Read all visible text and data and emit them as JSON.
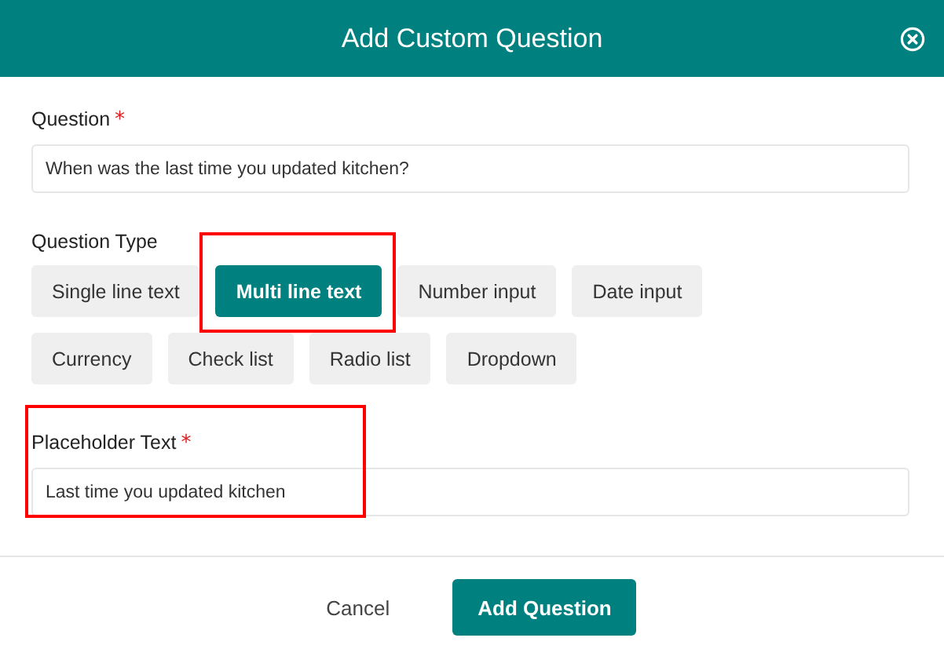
{
  "dialog": {
    "title": "Add Custom Question"
  },
  "question": {
    "label": "Question",
    "required_mark": "*",
    "value": "When was the last time you updated kitchen?"
  },
  "question_type": {
    "label": "Question Type",
    "options": [
      {
        "label": "Single line text",
        "selected": false,
        "highlighted": false
      },
      {
        "label": "Multi line text",
        "selected": true,
        "highlighted": true
      },
      {
        "label": "Number input",
        "selected": false,
        "highlighted": false
      },
      {
        "label": "Date input",
        "selected": false,
        "highlighted": false
      },
      {
        "label": "Currency",
        "selected": false,
        "highlighted": false
      },
      {
        "label": "Check list",
        "selected": false,
        "highlighted": false
      },
      {
        "label": "Radio list",
        "selected": false,
        "highlighted": false
      },
      {
        "label": "Dropdown",
        "selected": false,
        "highlighted": false
      }
    ]
  },
  "placeholder_text": {
    "label": "Placeholder Text",
    "required_mark": "*",
    "value": "Last time you updated kitchen",
    "highlighted": true
  },
  "buttons": [
    {
      "label": "Cancel",
      "kind": "secondary"
    },
    {
      "label": "Add Question",
      "kind": "primary"
    }
  ]
}
